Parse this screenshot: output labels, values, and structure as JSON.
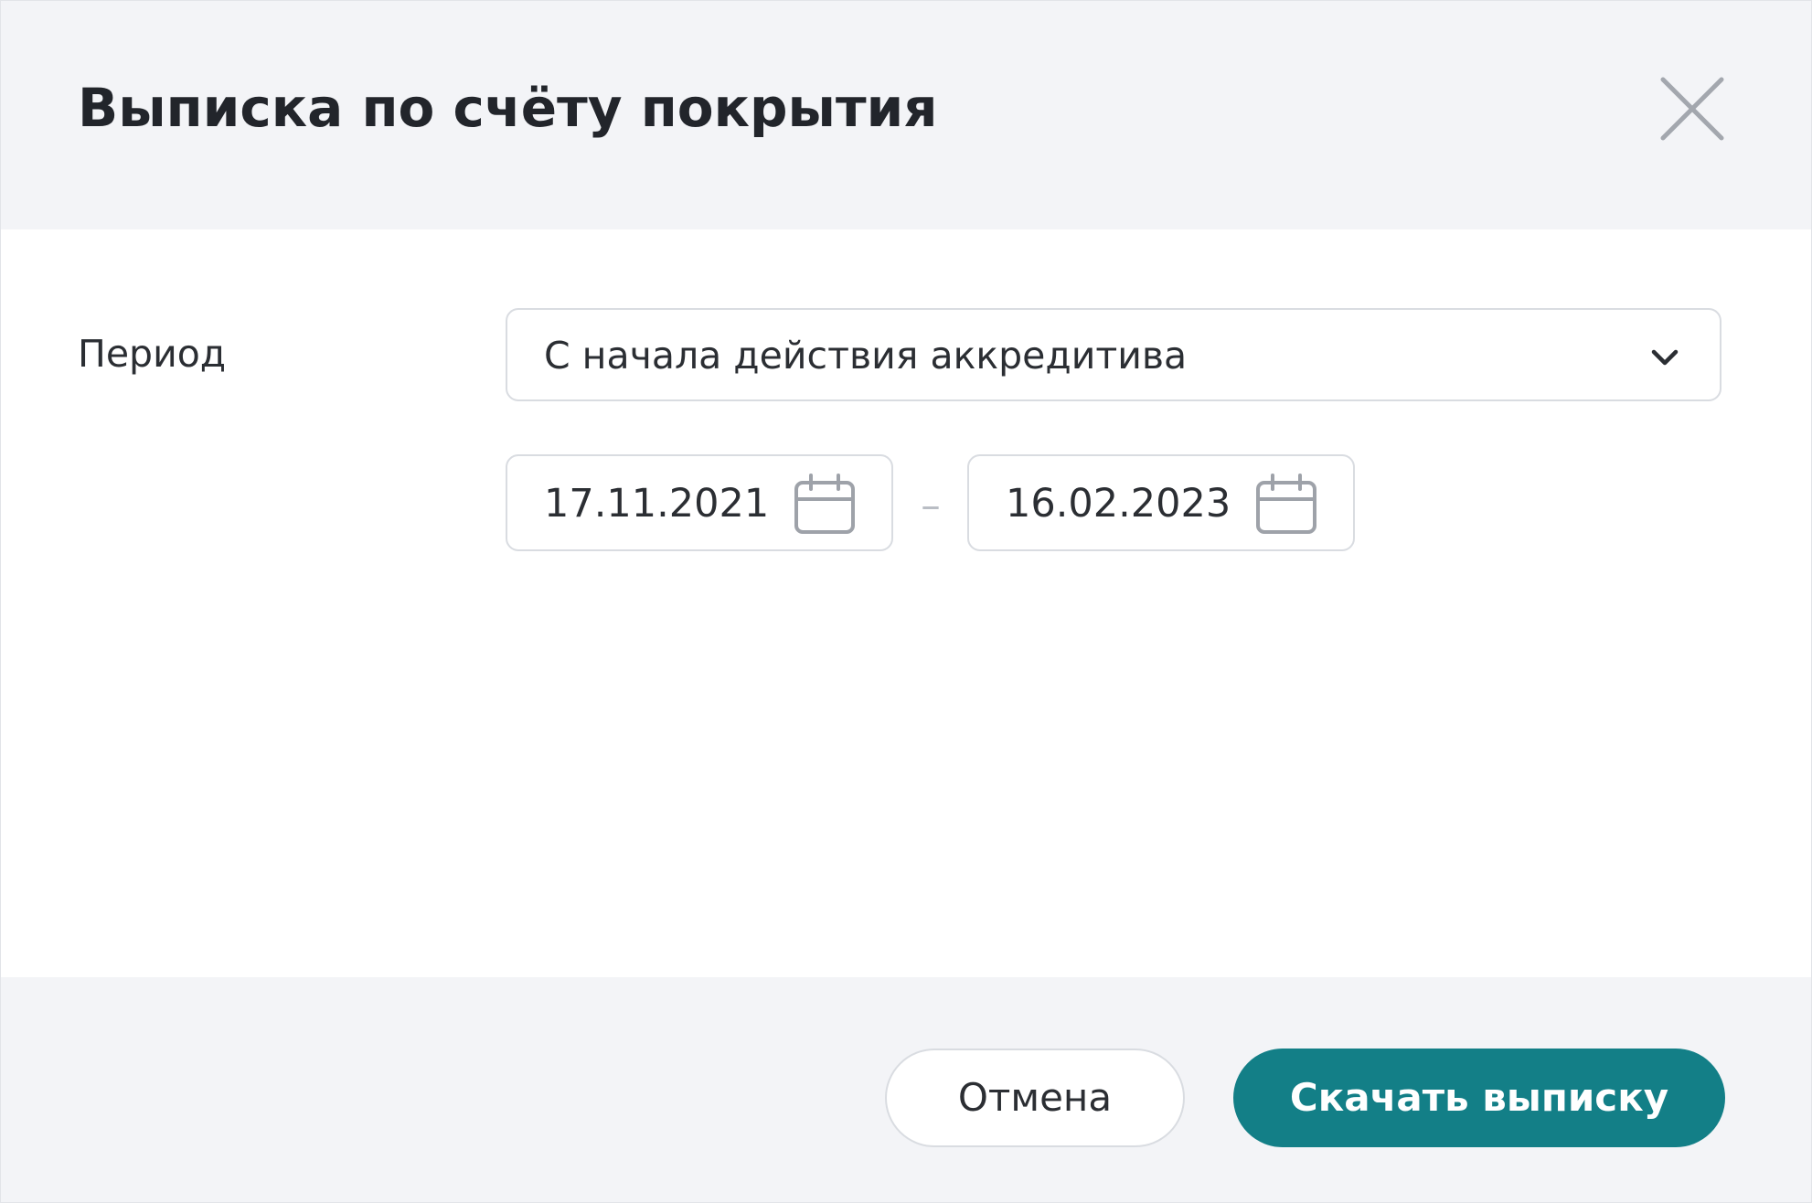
{
  "dialog": {
    "title": "Выписка по счёту покрытия",
    "close_icon": "close-icon"
  },
  "period": {
    "label": "Период",
    "selected_option": "С начала действия аккредитива",
    "dropdown_icon": "chevron-down-icon",
    "date_from": "17.11.2021",
    "date_to": "16.02.2023",
    "range_separator": "–",
    "calendar_icon": "calendar-icon"
  },
  "footer": {
    "cancel_label": "Отмена",
    "download_label": "Скачать выписку"
  },
  "colors": {
    "header_background": "#f3f4f7",
    "primary_button": "#137f87",
    "border": "#d9dce1",
    "text": "#2b2e33"
  }
}
